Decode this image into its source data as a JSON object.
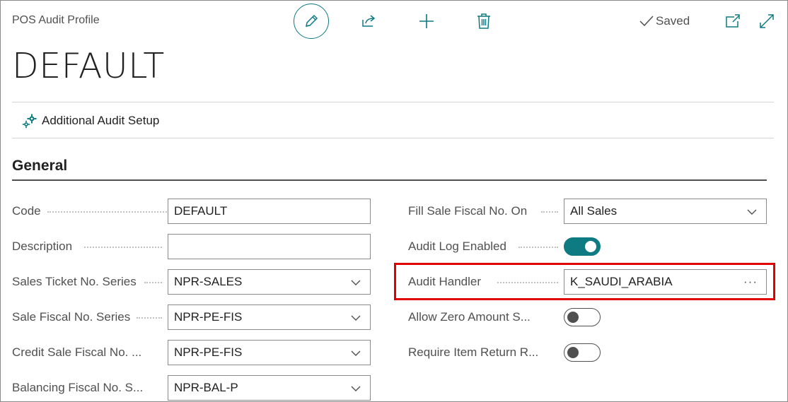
{
  "header": {
    "caption": "POS Audit Profile",
    "saved_label": "Saved",
    "title": "DEFAULT",
    "actions": {
      "edit_icon": "pencil-icon",
      "share_icon": "share-icon",
      "new_icon": "plus-icon",
      "delete_icon": "trash-icon",
      "open_new_icon": "open-in-new-window-icon",
      "expand_icon": "expand-icon"
    }
  },
  "action_bar": {
    "items": [
      {
        "label": "Additional Audit Setup",
        "icon": "gears-icon"
      }
    ]
  },
  "general": {
    "title": "General",
    "left_fields": [
      {
        "label": "Code",
        "value": "DEFAULT",
        "type": "text"
      },
      {
        "label": "Description",
        "value": "",
        "type": "text"
      },
      {
        "label": "Sales Ticket No. Series",
        "value": "NPR-SALES",
        "type": "select"
      },
      {
        "label": "Sale Fiscal No. Series",
        "value": "NPR-PE-FIS",
        "type": "select"
      },
      {
        "label": "Credit Sale Fiscal No. ...",
        "value": "NPR-PE-FIS",
        "type": "select"
      },
      {
        "label": "Balancing Fiscal No. S...",
        "value": "NPR-BAL-P",
        "type": "select"
      }
    ],
    "right_fields": [
      {
        "label": "Fill Sale Fiscal No. On",
        "value": "All Sales",
        "type": "select"
      },
      {
        "label": "Audit Log Enabled",
        "value": true,
        "type": "toggle"
      },
      {
        "label": "Audit Handler",
        "value": "K_SAUDI_ARABIA",
        "type": "lookup",
        "lookup_glyph": "···"
      },
      {
        "label": "Allow Zero Amount S...",
        "value": false,
        "type": "toggle"
      },
      {
        "label": "Require Item Return R...",
        "value": false,
        "type": "toggle"
      }
    ]
  },
  "colors": {
    "accent": "#0e7a82",
    "highlight": "#e00000",
    "text": "#212121",
    "muted_text": "#505050"
  }
}
